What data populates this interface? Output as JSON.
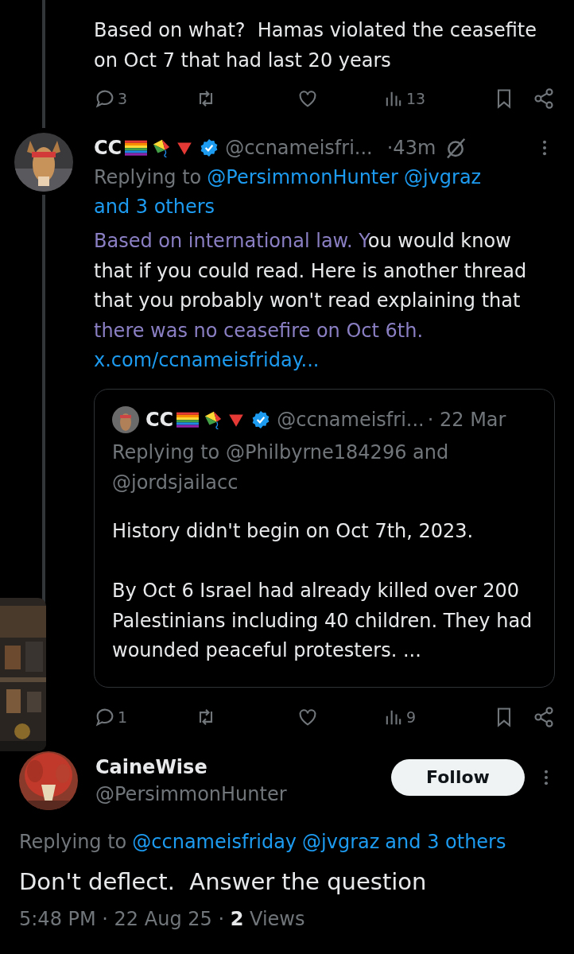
{
  "previous_reply": {
    "text": "Based on what?  Hamas violated the ceasefite on Oct 7 that had last 20 years",
    "replies": "3",
    "views": "13"
  },
  "reply": {
    "name": "CC",
    "handle": "@ccnameisfri...",
    "time": "·43m",
    "replying_label": "Replying to",
    "mentions": [
      "@PersimmonHunter",
      "@jvgraz",
      "and 3 others"
    ],
    "body": [
      {
        "kind": "highlight",
        "text": "Based on international law. Y"
      },
      {
        "kind": "plain",
        "text": "ou would know that if you could read. Here is another thread that you probably won't read explaining that "
      },
      {
        "kind": "highlight",
        "text": "there was no ceasefire on Oct 6th."
      },
      {
        "kind": "link",
        "text": "x.com/ccnameisfriday..."
      }
    ],
    "quote": {
      "name": "CC",
      "handle": "@ccnameisfri...",
      "time": "· 22 Mar",
      "replying": "Replying to @Philbyrne184296 and @jordsjailacc",
      "paragraphs": [
        "History didn't begin on Oct 7th, 2023.",
        "By Oct 6 Israel had already killed over 200 Palestinians including 40 children. They had wounded peaceful protesters. ..."
      ]
    },
    "replies": "1",
    "views": "9"
  },
  "focused": {
    "name": "CaineWise",
    "handle": "@PersimmonHunter",
    "follow": "Follow",
    "replying_label": "Replying to",
    "mentions": [
      "@ccnameisfriday",
      "@jvgraz",
      "and 3 others"
    ],
    "text": "Don't deflect.  Answer the question",
    "meta": "5:48 PM · 22 Aug 25 · **2** Views"
  }
}
